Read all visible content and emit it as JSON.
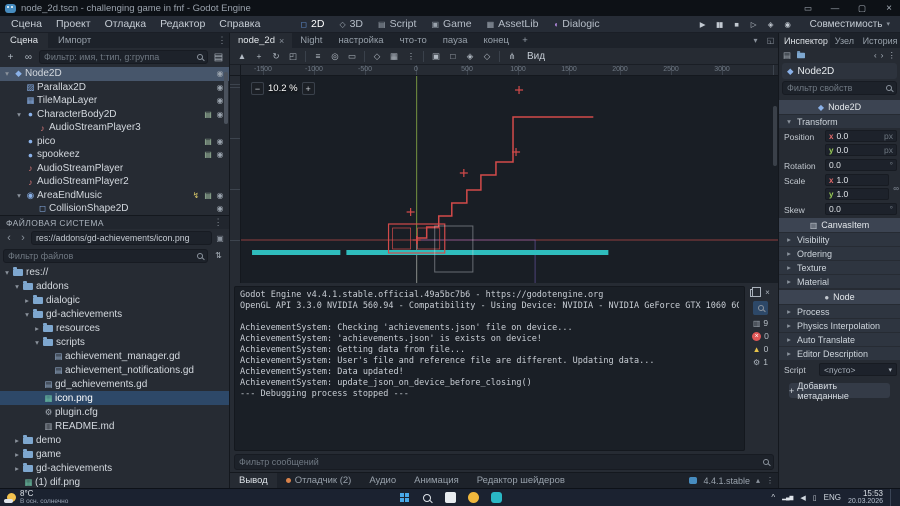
{
  "colors": {
    "accent": "#699ce8",
    "axis-x": "#c14b4b",
    "axis-y": "#6e9a3e",
    "platform": "#2fbdbd",
    "scene-red": "#d24a4a",
    "error": "#e05555",
    "warning": "#e6c24a"
  },
  "icons": {
    "console": "▭",
    "minimize": "—",
    "maximize": "▢",
    "close": "×",
    "play": "▶",
    "pause": "▮▮",
    "stop": "■",
    "play-scene": "▷",
    "play-custom": "◈",
    "movie": "◉",
    "dropdown": "▾",
    "expand": "▸",
    "collapse": "▾",
    "dots": "⋮",
    "plus": "+",
    "minus": "−",
    "instance": "∞",
    "attach-script": "▤",
    "back": "‹",
    "forward": "›",
    "sort": "⇅",
    "focus": "▣",
    "panel-collapse": "▴",
    "tab-float": "◱",
    "eye": "◉",
    "script": "▤",
    "signal": "↯",
    "node2d": "◆",
    "parallax": "▨",
    "tilemap": "▦",
    "body": "●",
    "audio": "♪",
    "area": "◉",
    "shape": "◻",
    "gd": "▤",
    "image": "▦",
    "doc": "▥",
    "gear": "⚙",
    "select": "▲",
    "move": "+",
    "rotate": "↻",
    "scale": "◰",
    "list": "≡",
    "pivot": "◎",
    "ruler": "▭",
    "smart-snap": "◇",
    "grid-snap": "▦",
    "lock": "▣",
    "unlock": "□",
    "group": "◈",
    "ungroup": "◇",
    "skeleton": "⋔",
    "error-x": "×",
    "warning-tri": "▲",
    "link": "∞",
    "chevron-up": "^",
    "cell-bars": "▂▄▆",
    "volume": "◀",
    "battery": "▯"
  },
  "window": {
    "title": "node_2d.tscn - challenging game in fnf - Godot Engine"
  },
  "menubar": {
    "items": [
      "Сцена",
      "Проект",
      "Отладка",
      "Редактор",
      "Справка"
    ],
    "workspaces": [
      "2D",
      "3D",
      "Script",
      "Game",
      "AssetLib",
      "Dialogic"
    ],
    "renderer": "Совместимость"
  },
  "scene_dock": {
    "tabs": [
      "Сцена",
      "Импорт"
    ],
    "filter_placeholder": "Фильтр: имя, t:тип, g:группа",
    "tree": [
      {
        "label": "Node2D",
        "icon": "node2d"
      },
      {
        "label": "Parallax2D",
        "icon": "parallax"
      },
      {
        "label": "TileMapLayer",
        "icon": "tilemap"
      },
      {
        "label": "CharacterBody2D",
        "icon": "body"
      },
      {
        "label": "AudioStreamPlayer3",
        "icon": "audio"
      },
      {
        "label": "pico",
        "icon": "body"
      },
      {
        "label": "spookeez",
        "icon": "body"
      },
      {
        "label": "AudioStreamPlayer",
        "icon": "audio"
      },
      {
        "label": "AudioStreamPlayer2",
        "icon": "audio"
      },
      {
        "label": "AreaEndMusic",
        "icon": "area"
      },
      {
        "label": "CollisionShape2D",
        "icon": "shape"
      }
    ]
  },
  "filesystem_dock": {
    "title": "ФАЙЛОВАЯ СИСТЕМА",
    "path": "res://addons/gd-achievements/icon.png",
    "filter_placeholder": "Фильтр файлов",
    "tree": [
      {
        "label": "res://",
        "icon": "folder"
      },
      {
        "label": "addons",
        "icon": "folder"
      },
      {
        "label": "dialogic",
        "icon": "folder"
      },
      {
        "label": "gd-achievements",
        "icon": "folder"
      },
      {
        "label": "resources",
        "icon": "folder"
      },
      {
        "label": "scripts",
        "icon": "folder"
      },
      {
        "label": "achievement_manager.gd",
        "icon": "gd"
      },
      {
        "label": "achievement_notifications.gd",
        "icon": "gd"
      },
      {
        "label": "gd_achievements.gd",
        "icon": "gd"
      },
      {
        "label": "icon.png",
        "icon": "image"
      },
      {
        "label": "plugin.cfg",
        "icon": "gear"
      },
      {
        "label": "README.md",
        "icon": "doc"
      },
      {
        "label": "demo",
        "icon": "folder"
      },
      {
        "label": "game",
        "icon": "folder"
      },
      {
        "label": "gd-achievements",
        "icon": "folder"
      },
      {
        "label": "(1) dif.png",
        "icon": "image"
      }
    ]
  },
  "main": {
    "tabs": [
      "node_2d",
      "Night",
      "настройка",
      "что-то",
      "пауза",
      "конец"
    ],
    "zoom": "10.2 %",
    "view_menu": "Вид",
    "ruler_labels": [
      "-1500",
      "-1000",
      "-500",
      "0",
      "500",
      "1000",
      "1500",
      "2000",
      "2500",
      "3000"
    ]
  },
  "output": {
    "lines": [
      "Godot Engine v4.4.1.stable.official.49a5bc7b6 - https://godotengine.org",
      "OpenGL API 3.3.0 NVIDIA 560.94 - Compatibility - Using Device: NVIDIA - NVIDIA GeForce GTX 1060 6GB",
      "",
      "AchievementSystem: Checking 'achievements.json' file on device...",
      "AchievementSystem: 'achievements.json' is exists on device!",
      "AchievementSystem: Getting data from file...",
      "AchievementSystem: User's file and reference file are different. Updating data...",
      "AchievementSystem: Data updated!",
      "AchievementSystem: update_json_on_device_before_closing()",
      "--- Debugging process stopped ---"
    ],
    "filter_placeholder": "Фильтр сообщений",
    "counts": {
      "log": "9",
      "errors": "0",
      "warnings": "0",
      "editor": "1"
    }
  },
  "bottom_bar": {
    "tabs": [
      "Вывод",
      "Отладчик (2)",
      "Аудио",
      "Анимация",
      "Редактор шейдеров"
    ],
    "version": "4.4.1.stable"
  },
  "inspector": {
    "tabs": [
      "Инспектор",
      "Узел",
      "История"
    ],
    "node_name": "Node2D",
    "filter_placeholder": "Фильтр свойств",
    "categories": [
      "Node2D",
      "CanvasItem",
      "Node"
    ],
    "transform": {
      "header": "Transform",
      "axis_x": "x",
      "axis_y": "y",
      "position": {
        "label": "Position",
        "x": "0.0",
        "y": "0.0",
        "unit": "px"
      },
      "rotation": {
        "label": "Rotation",
        "value": "0.0",
        "unit": "°"
      },
      "scale": {
        "label": "Scale",
        "x": "1.0",
        "y": "1.0"
      },
      "skew": {
        "label": "Skew",
        "value": "0.0",
        "unit": "°"
      }
    },
    "canvasitem_sections": [
      "Visibility",
      "Ordering",
      "Texture",
      "Material"
    ],
    "node_sections": [
      "Process",
      "Physics Interpolation",
      "Auto Translate",
      "Editor Description"
    ],
    "script": {
      "label": "Script",
      "value": "<пусто>"
    },
    "add_metadata": "Добавить метаданные"
  },
  "taskbar": {
    "temperature": "8°C",
    "weather": "В осн. солнечно",
    "lang": "ENG",
    "time": "15:53",
    "date": "20.03.2026"
  }
}
